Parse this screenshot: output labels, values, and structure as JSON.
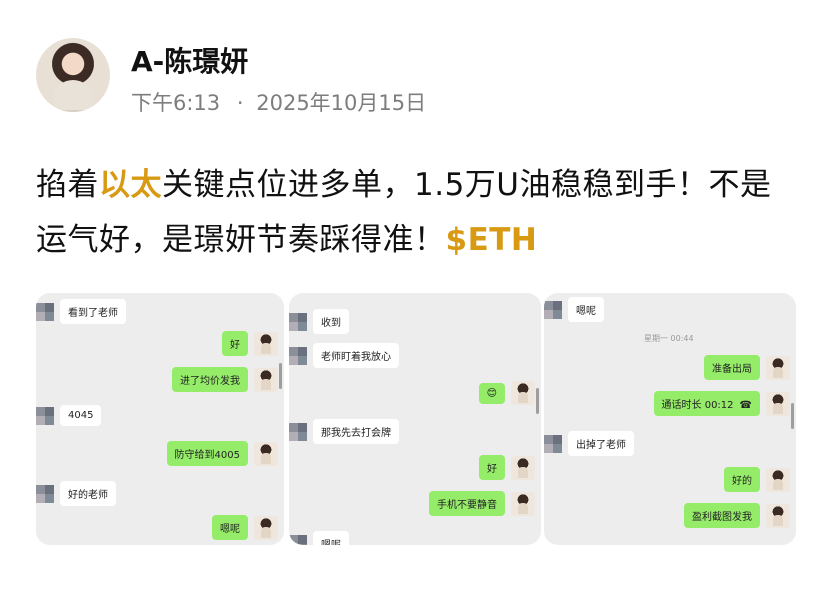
{
  "author": {
    "name": "A-陈璟妍",
    "time": "下午6:13",
    "date": "2025年10月15日",
    "separator": "·"
  },
  "post": {
    "part1": "掐着",
    "highlight": "以太",
    "part2": "关键点位进多单，1.5万U油稳稳到手！不是运气好，是璟妍节奏踩得准！",
    "tag": "$ETH"
  },
  "chat1": {
    "messages": [
      {
        "from": "them",
        "text": "看到了老师"
      },
      {
        "from": "me",
        "text": "好"
      },
      {
        "from": "me",
        "text": "进了均价发我"
      },
      {
        "from": "them",
        "text": "4045"
      },
      {
        "from": "me",
        "text": "防守给到4005"
      },
      {
        "from": "them",
        "text": "好的老师"
      },
      {
        "from": "me",
        "text": "嗯呢"
      }
    ]
  },
  "chat2": {
    "messages": [
      {
        "from": "them",
        "text": "收到"
      },
      {
        "from": "them",
        "text": "老师盯着我放心"
      },
      {
        "from": "me",
        "text": "😊"
      },
      {
        "from": "them",
        "text": "那我先去打会牌"
      },
      {
        "from": "me",
        "text": "好"
      },
      {
        "from": "me",
        "text": "手机不要静音"
      },
      {
        "from": "them",
        "text": "嗯呢"
      }
    ]
  },
  "chat3": {
    "timestamp": "星期一 00:44",
    "messages": [
      {
        "from": "them",
        "text": "嗯呢"
      },
      {
        "from": "me",
        "text": "准备出局"
      },
      {
        "from": "me",
        "text": "通话时长 00:12"
      },
      {
        "from": "them",
        "text": "出掉了老师"
      },
      {
        "from": "me",
        "text": "好的"
      },
      {
        "from": "me",
        "text": "盈利截图发我"
      }
    ]
  }
}
